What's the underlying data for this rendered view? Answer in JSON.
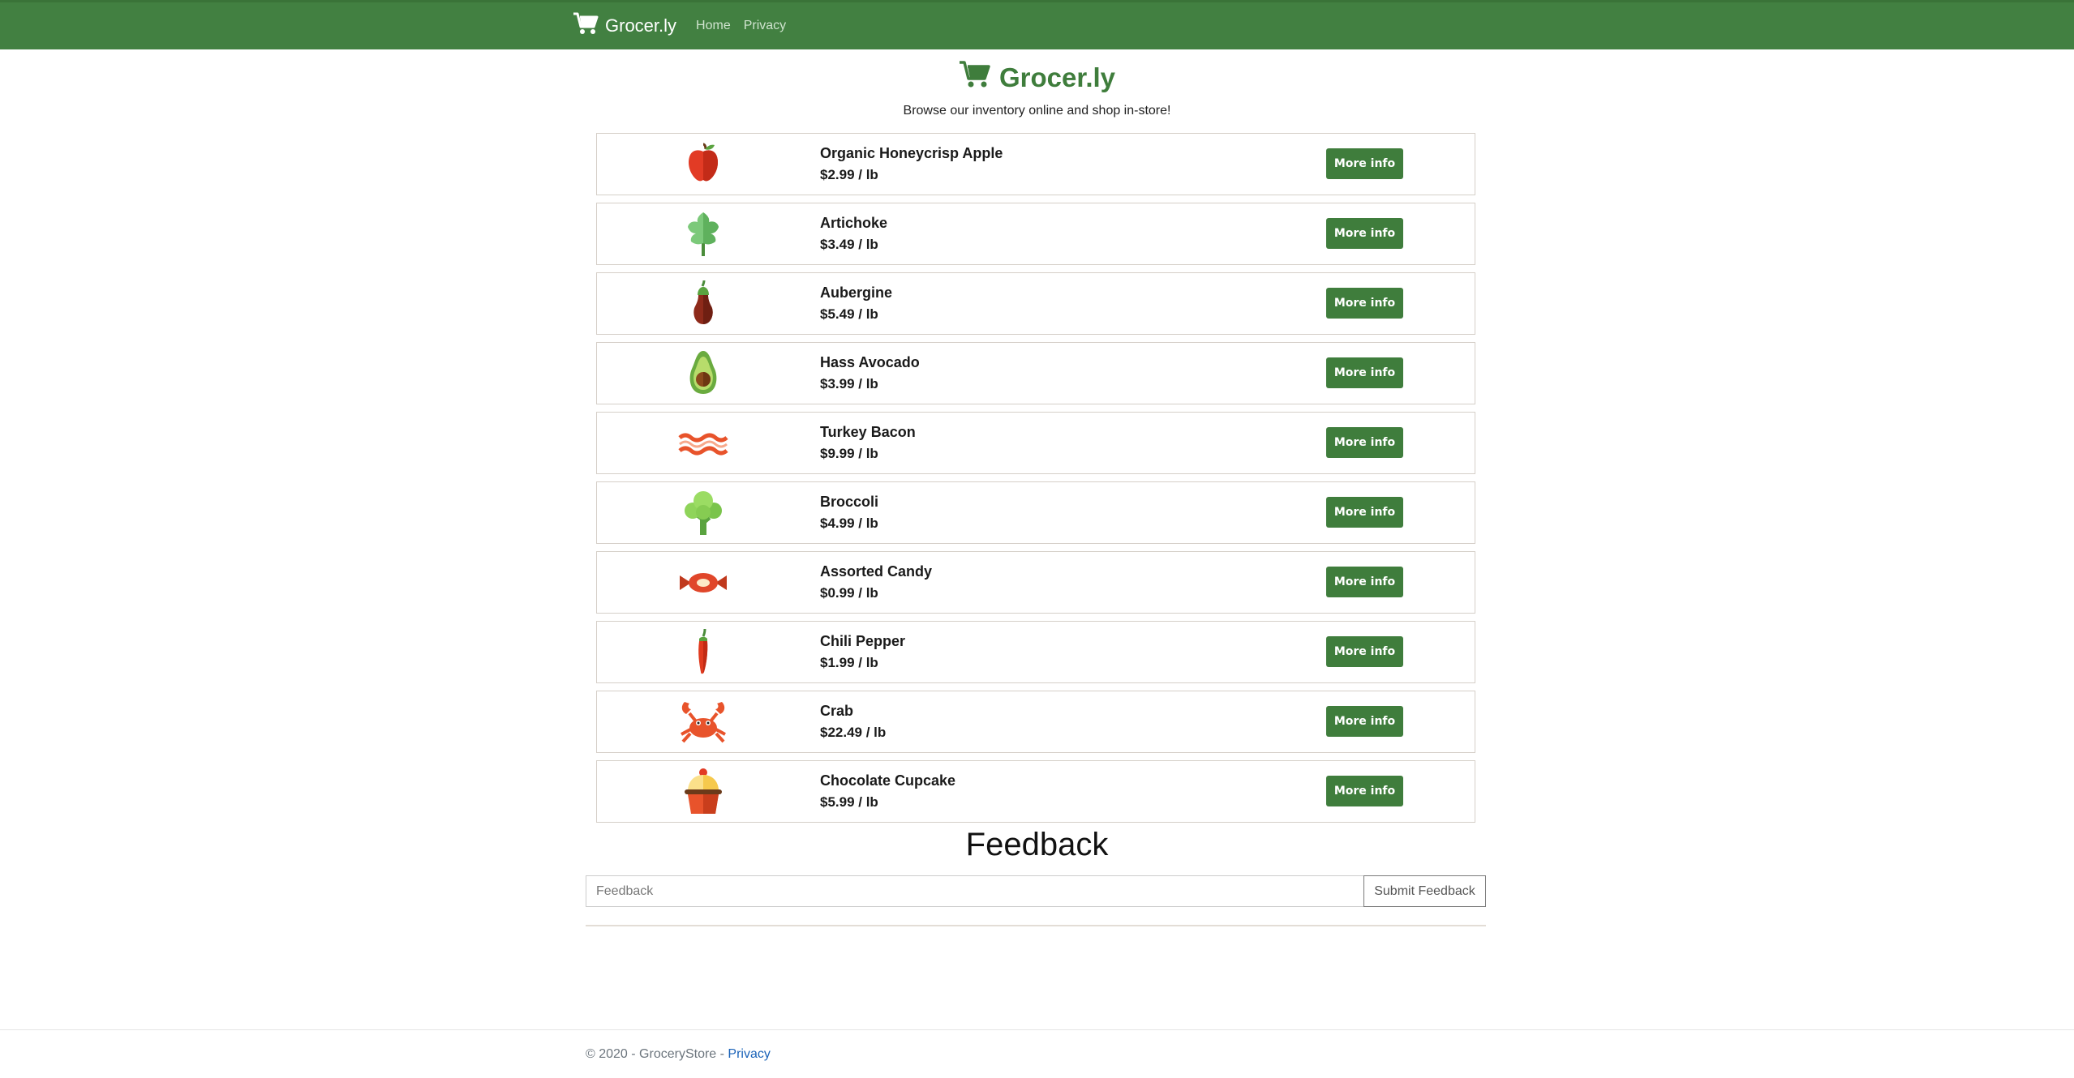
{
  "navbar": {
    "brand": "Grocer.ly",
    "links": [
      "Home",
      "Privacy"
    ]
  },
  "hero": {
    "title": "Grocer.ly",
    "subtitle": "Browse our inventory online and shop in-store!"
  },
  "products": [
    {
      "name": "Organic Honeycrisp Apple",
      "price": "$2.99 / lb",
      "icon": "apple-icon",
      "button": "More info"
    },
    {
      "name": "Artichoke",
      "price": "$3.49 / lb",
      "icon": "artichoke-icon",
      "button": "More info"
    },
    {
      "name": "Aubergine",
      "price": "$5.49 / lb",
      "icon": "aubergine-icon",
      "button": "More info"
    },
    {
      "name": "Hass Avocado",
      "price": "$3.99 / lb",
      "icon": "avocado-icon",
      "button": "More info"
    },
    {
      "name": "Turkey Bacon",
      "price": "$9.99 / lb",
      "icon": "bacon-icon",
      "button": "More info"
    },
    {
      "name": "Broccoli",
      "price": "$4.99 / lb",
      "icon": "broccoli-icon",
      "button": "More info"
    },
    {
      "name": "Assorted Candy",
      "price": "$0.99 / lb",
      "icon": "candy-icon",
      "button": "More info"
    },
    {
      "name": "Chili Pepper",
      "price": "$1.99 / lb",
      "icon": "chili-pepper-icon",
      "button": "More info"
    },
    {
      "name": "Crab",
      "price": "$22.49 / lb",
      "icon": "crab-icon",
      "button": "More info"
    },
    {
      "name": "Chocolate Cupcake",
      "price": "$5.99 / lb",
      "icon": "cupcake-icon",
      "button": "More info"
    }
  ],
  "feedback": {
    "title": "Feedback",
    "placeholder": "Feedback",
    "submit_label": "Submit Feedback"
  },
  "footer": {
    "text": "© 2020 - GroceryStore - ",
    "link": "Privacy"
  },
  "colors": {
    "brand_green": "#428041",
    "title_green": "#3f7d3c",
    "link_blue": "#1a62b8"
  }
}
